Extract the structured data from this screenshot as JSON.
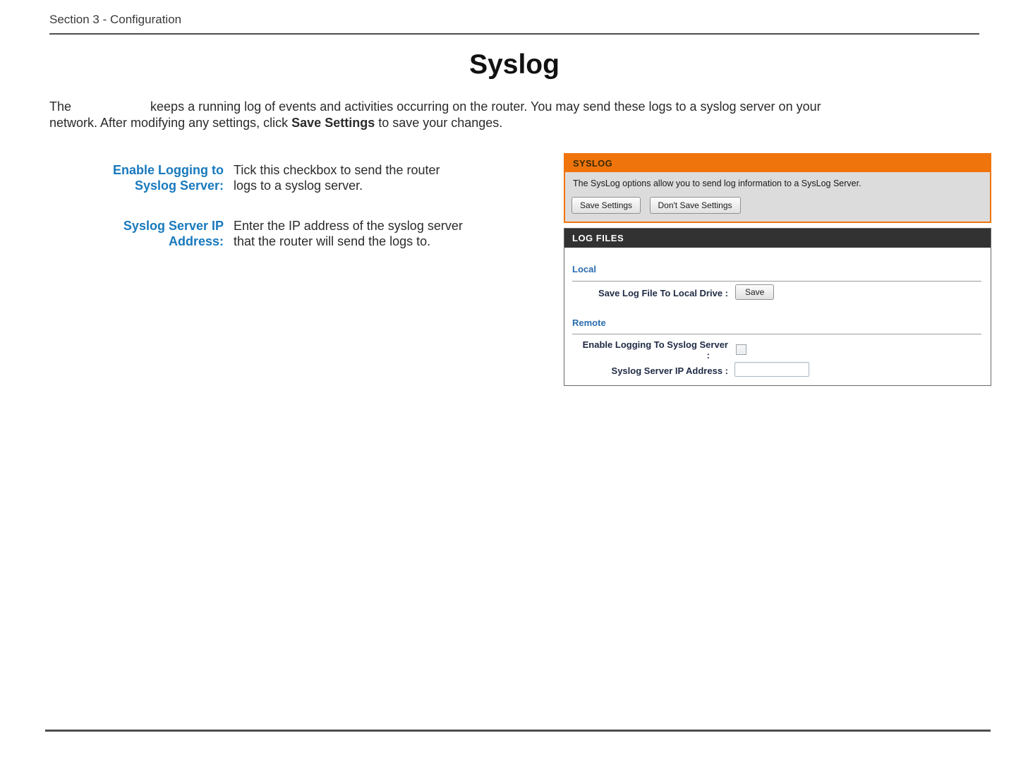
{
  "doc": {
    "section_header": "Section 3 - Configuration",
    "title": "Syslog",
    "intro": {
      "line1_start": "The",
      "line1_rest": "keeps a running log of events and activities occurring on the router. You may send these logs to a syslog server on your",
      "line2_pre": "network. After modifying any settings, click ",
      "line2_bold": "Save Settings",
      "line2_post": " to save your changes."
    },
    "help_rows": [
      {
        "label_line1": "Enable Logging to",
        "label_line2": "Syslog Server:",
        "desc_line1": "Tick this checkbox to send the router",
        "desc_line2": "logs to a syslog server."
      },
      {
        "label_line1": "Syslog Server IP",
        "label_line2": "Address:",
        "desc_line1": "Enter the IP address of the syslog server",
        "desc_line2": "that the router will send the logs to."
      }
    ]
  },
  "screenshot": {
    "syslog_box": {
      "title": "SYSLOG",
      "description": "The SysLog options allow you to send log information to a SysLog Server.",
      "save_button": "Save Settings",
      "dont_save_button": "Don't Save Settings"
    },
    "log_files_box": {
      "title": "LOG FILES",
      "local_heading": "Local",
      "save_log_label": "Save Log File To Local Drive :",
      "save_button": "Save",
      "remote_heading": "Remote",
      "enable_logging_label": "Enable Logging To Syslog Server",
      "enable_logging_colon": ":",
      "enable_logging_checked": false,
      "ip_label": "Syslog Server IP Address :",
      "ip_value": ""
    }
  },
  "colors": {
    "accent_orange": "#F0740C",
    "dlink_blue": "#1879BE",
    "section_blue": "#2A6DAE",
    "label_navy": "#1F2A44",
    "dark_header": "#323232",
    "gray_panel": "#DCDCDC"
  }
}
